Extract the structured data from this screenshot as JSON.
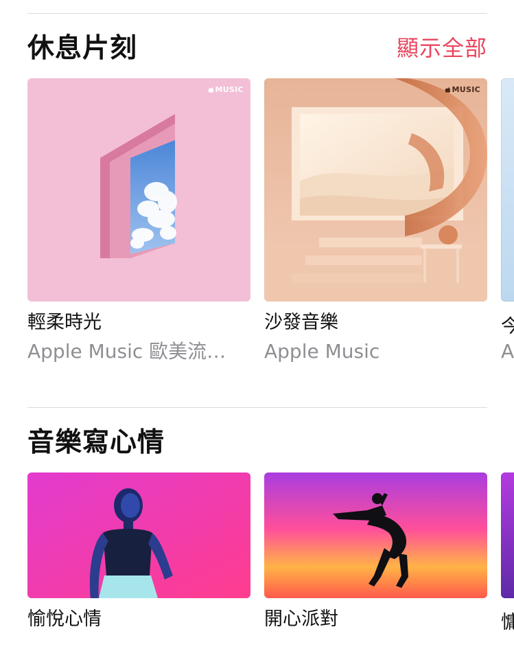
{
  "colors": {
    "accent": "#e8455e",
    "text_primary": "#111111",
    "text_secondary": "#8e8e93",
    "divider": "#d9d9d9"
  },
  "sections": [
    {
      "title": "休息片刻",
      "see_all_label": "顯示全部",
      "cards": [
        {
          "title": "輕柔時光",
          "subtitle": "Apple Music 歐美流…",
          "badge": "MUSIC"
        },
        {
          "title": "沙發音樂",
          "subtitle": "Apple Music",
          "badge": "MUSIC"
        },
        {
          "title": "今",
          "subtitle": "A"
        }
      ]
    },
    {
      "title": "音樂寫心情",
      "cards": [
        {
          "title": "愉悅心情"
        },
        {
          "title": "開心派對"
        },
        {
          "title": "慵"
        }
      ]
    }
  ]
}
